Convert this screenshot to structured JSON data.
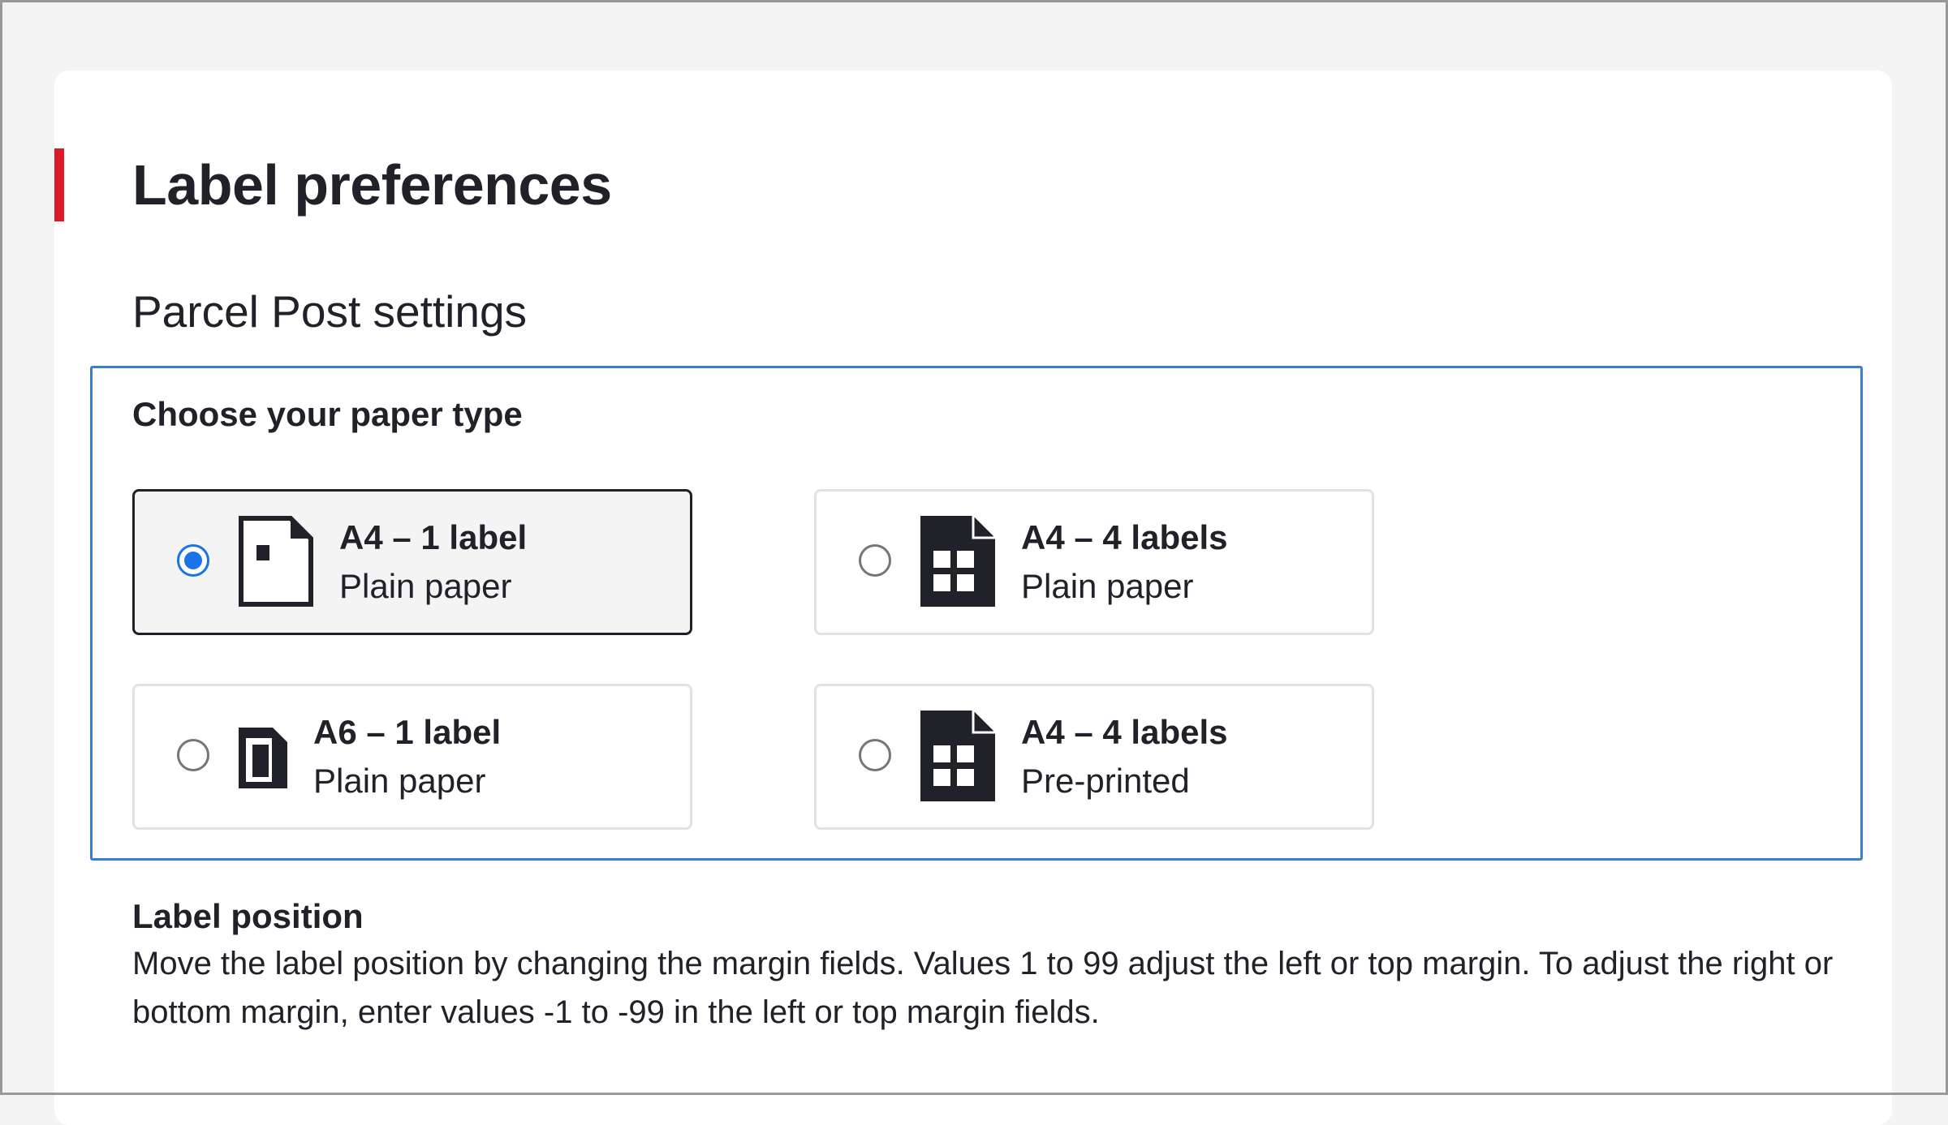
{
  "page": {
    "title": "Label preferences",
    "accent_color": "#dc1928"
  },
  "section": {
    "title": "Parcel Post settings"
  },
  "paper_type": {
    "legend": "Choose your paper type",
    "selected_index": 0,
    "options": [
      {
        "title": "A4 – 1 label",
        "subtitle": "Plain paper",
        "icon": "a4-single-label-icon",
        "selected": true
      },
      {
        "title": "A4 – 4 labels",
        "subtitle": "Plain paper",
        "icon": "a4-four-labels-icon",
        "selected": false
      },
      {
        "title": "A6 – 1 label",
        "subtitle": "Plain paper",
        "icon": "a6-single-label-icon",
        "selected": false
      },
      {
        "title": "A4 – 4 labels",
        "subtitle": "Pre-printed",
        "icon": "a4-four-labels-icon",
        "selected": false
      }
    ]
  },
  "label_position": {
    "heading": "Label position",
    "description": "Move the label position by changing the margin fields. Values 1 to 99 adjust the left or top margin. To adjust the right or bottom margin, enter values -1 to -99 in the left or top margin fields."
  },
  "colors": {
    "focus_border": "#3a7fcf",
    "radio_checked": "#1a73e8",
    "text": "#212129"
  }
}
